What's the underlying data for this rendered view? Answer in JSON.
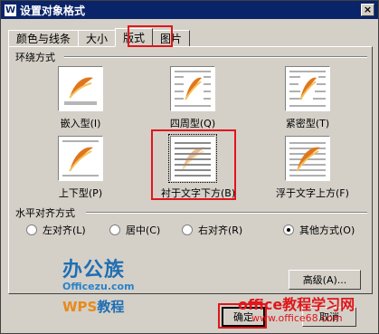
{
  "window": {
    "title": "设置对象格式",
    "logo": "W",
    "close": "×"
  },
  "tabs": [
    {
      "label": "颜色与线条"
    },
    {
      "label": "大小"
    },
    {
      "label": "版式"
    },
    {
      "label": "图片"
    }
  ],
  "wrap": {
    "section": "环绕方式",
    "options": [
      {
        "label": "嵌入型(I)"
      },
      {
        "label": "四周型(Q)"
      },
      {
        "label": "紧密型(T)"
      },
      {
        "label": "上下型(P)"
      },
      {
        "label": "衬于文字下方(B)"
      },
      {
        "label": "浮于文字上方(F)"
      }
    ],
    "selected_index": 4
  },
  "align": {
    "section": "水平对齐方式",
    "options": [
      {
        "label": "左对齐(L)"
      },
      {
        "label": "居中(C)"
      },
      {
        "label": "右对齐(R)"
      },
      {
        "label": "其他方式(O)"
      }
    ],
    "selected_index": 3
  },
  "buttons": {
    "advanced": "高级(A)...",
    "ok": "确定",
    "cancel": "取消"
  },
  "watermark": {
    "brand": "办公族",
    "site": "Officezu.com",
    "wps": "WPS",
    "wps_suffix": "教程",
    "right_big": "office教程学习网",
    "right_small": "www.office68.com"
  },
  "colors": {
    "highlight": "#e0161b",
    "title_bar": "#0a246a"
  }
}
